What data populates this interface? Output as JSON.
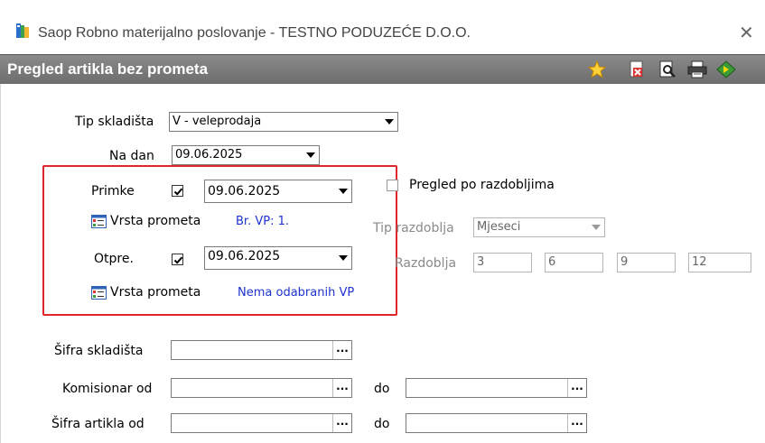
{
  "window": {
    "title": "Saop Robno materijalno poslovanje - TESTNO PODUZEĆE D.O.O.",
    "close_glyph": "✕"
  },
  "header": {
    "title": "Pregled artikla bez prometa",
    "icons": [
      "star-icon",
      "delete-icon",
      "print-preview-icon",
      "printer-icon",
      "exit-icon"
    ]
  },
  "form": {
    "tip_skladista": {
      "label": "Tip skladišta",
      "value": "V - veleprodaja"
    },
    "na_dan": {
      "label": "Na dan",
      "value": "09.06.2025"
    },
    "primke": {
      "label": "Primke",
      "checked": true,
      "date": "09.06.2025",
      "vrsta_label": "Vrsta prometa",
      "vrsta_value": "Br. VP: 1."
    },
    "otpre": {
      "label": "Otpre.",
      "checked": true,
      "date": "09.06.2025",
      "vrsta_label": "Vrsta prometa",
      "vrsta_value": "Nema odabranih VP"
    },
    "pregled_po_razdobljima": {
      "label": "Pregled po razdobljima",
      "checked": false
    },
    "tip_razdoblja": {
      "label": "Tip razdoblja",
      "value": "Mjeseci"
    },
    "razdoblja": {
      "label": "Razdoblja",
      "values": [
        "3",
        "6",
        "9",
        "12"
      ]
    },
    "sifra_skladista": {
      "label": "Šifra skladišta",
      "value": ""
    },
    "komisionar": {
      "label": "Komisionar od",
      "do_label": "do",
      "from": "",
      "to": ""
    },
    "sifra_artikla": {
      "label": "Šifra artikla od",
      "do_label": "do",
      "from": "",
      "to": ""
    },
    "dots_glyph": "..."
  },
  "colors": {
    "highlight_box": "#e0262b",
    "link_blue": "#1d32d0",
    "header_gray": "#7a7a7a"
  }
}
